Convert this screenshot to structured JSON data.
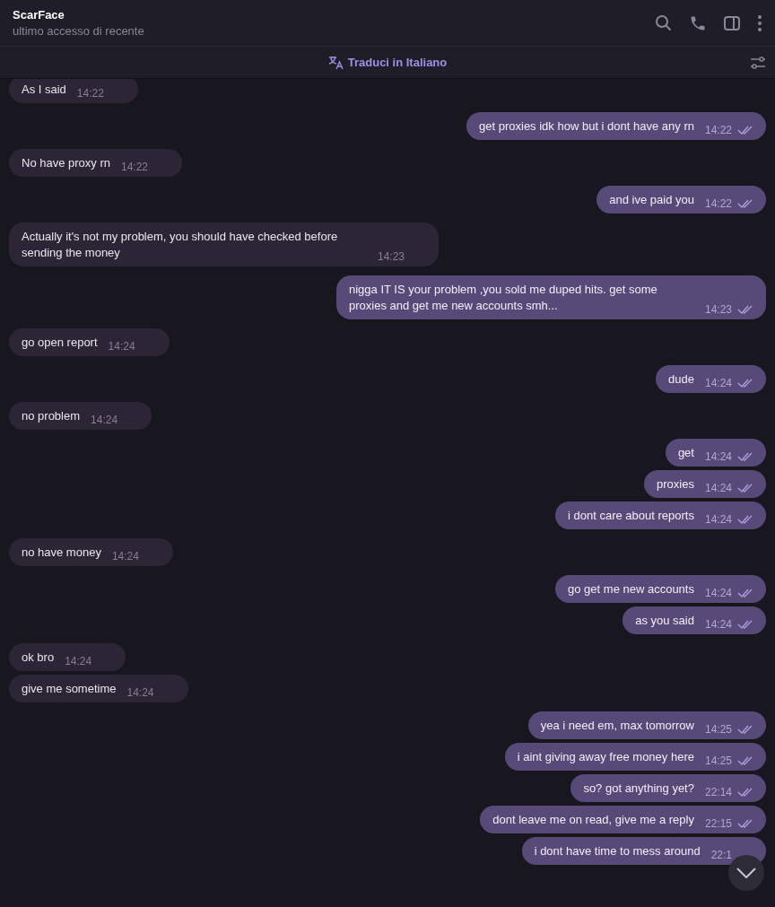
{
  "header": {
    "name": "ScarFace",
    "status": "ultimo accesso di recente"
  },
  "translate_bar": {
    "label": "Traduci in Italiano"
  },
  "messages": [
    {
      "kind": "incoming",
      "text": "As I said",
      "time": "14:22"
    },
    {
      "kind": "outgoing",
      "text": "get proxies idk how but i dont have any rn",
      "time": "14:22",
      "read": true
    },
    {
      "kind": "incoming",
      "text": "No have proxy rn",
      "time": "14:22"
    },
    {
      "kind": "outgoing",
      "text": "and ive paid you",
      "time": "14:22",
      "read": true
    },
    {
      "kind": "incoming",
      "text": "Actually it's not my problem, you should have checked before sending the money",
      "time": "14:23"
    },
    {
      "kind": "outgoing",
      "text": "nigga IT IS your problem ,you sold me duped hits. get some proxies and get me new accounts smh...",
      "time": "14:23",
      "read": true
    },
    {
      "kind": "incoming",
      "text": "go open report",
      "time": "14:24"
    },
    {
      "kind": "outgoing",
      "text": "dude",
      "time": "14:24",
      "read": true
    },
    {
      "kind": "incoming",
      "text": "no problem",
      "time": "14:24"
    },
    {
      "kind": "outgoing",
      "text": "get",
      "time": "14:24",
      "read": true
    },
    {
      "kind": "outgoing",
      "text": "proxies",
      "time": "14:24",
      "read": true
    },
    {
      "kind": "outgoing",
      "text": "i dont care about reports",
      "time": "14:24",
      "read": true
    },
    {
      "kind": "incoming",
      "text": "no have money",
      "time": "14:24"
    },
    {
      "kind": "outgoing",
      "text": "go get me new accounts",
      "time": "14:24",
      "read": true
    },
    {
      "kind": "outgoing",
      "text": "as you said",
      "time": "14:24",
      "read": true
    },
    {
      "kind": "incoming",
      "text": "ok bro",
      "time": "14:24"
    },
    {
      "kind": "incoming",
      "text": "give me sometime",
      "time": "14:24"
    },
    {
      "kind": "outgoing",
      "text": "yea i need em, max tomorrow",
      "time": "14:25",
      "read": true
    },
    {
      "kind": "outgoing",
      "text": "i aint giving away free money here",
      "time": "14:25",
      "read": true
    },
    {
      "kind": "outgoing",
      "text": "so? got anything yet?",
      "time": "22:14",
      "read": true
    },
    {
      "kind": "outgoing",
      "text": "dont leave me on read, give me a reply",
      "time": "22:15",
      "read": true
    },
    {
      "kind": "outgoing",
      "text": "i dont have time to mess around",
      "time": "22:1"
    }
  ]
}
